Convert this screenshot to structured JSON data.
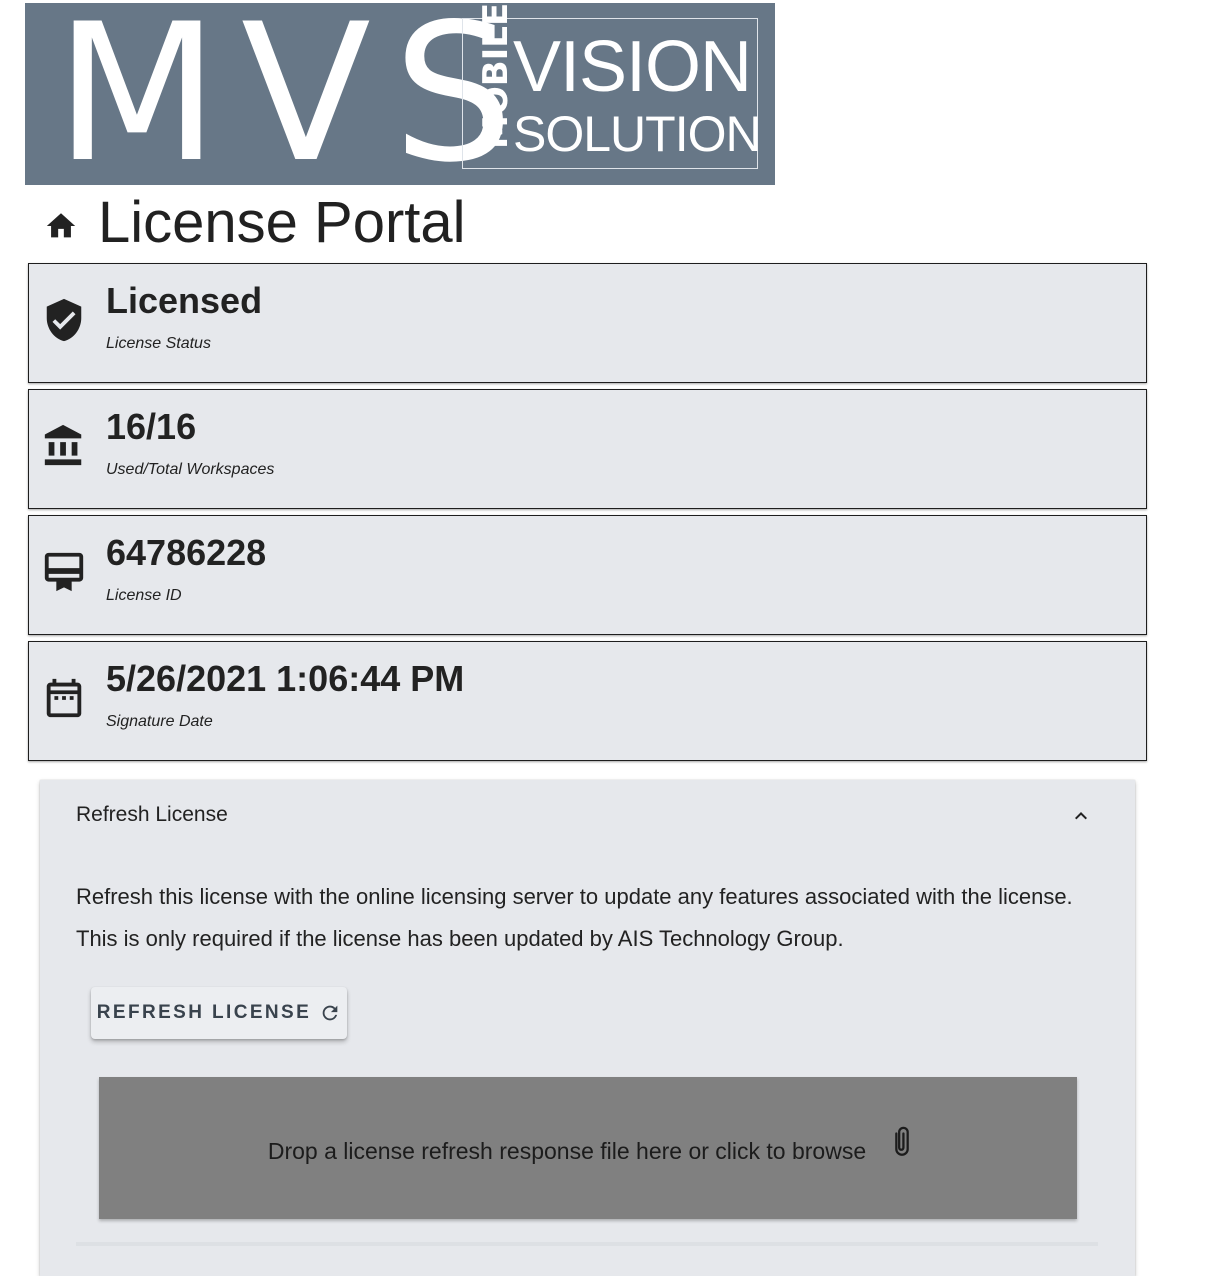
{
  "logo": {
    "mvs": "MVS",
    "mobile": "MOBILE",
    "vision": "VISION",
    "solution": "SOLUTION",
    "background_color": "#677787"
  },
  "header": {
    "icon": "home-icon",
    "title": "License Portal"
  },
  "cards": [
    {
      "icon": "verified-shield-icon",
      "value": "Licensed",
      "label": "License Status"
    },
    {
      "icon": "bank-icon",
      "value": "16/16",
      "label": "Used/Total Workspaces"
    },
    {
      "icon": "card-membership-icon",
      "value": "64786228",
      "label": "License ID"
    },
    {
      "icon": "calendar-icon",
      "value": "5/26/2021 1:06:44 PM",
      "label": "Signature Date"
    }
  ],
  "refresh_panel": {
    "title": "Refresh License",
    "expanded": true,
    "toggle_icon": "chevron-up-icon",
    "description": "Refresh this license with the online licensing server to update any features associated with the license. This is only required if the license has been updated by AIS Technology Group.",
    "button_label": "REFRESH LICENSE",
    "button_icon": "refresh-icon",
    "dropzone_text": "Drop a license refresh response file here or click to browse",
    "dropzone_icon": "paperclip-icon"
  },
  "colors": {
    "card_background": "#e6e8ec",
    "dropzone_background": "#808080",
    "button_text": "#39434d"
  }
}
